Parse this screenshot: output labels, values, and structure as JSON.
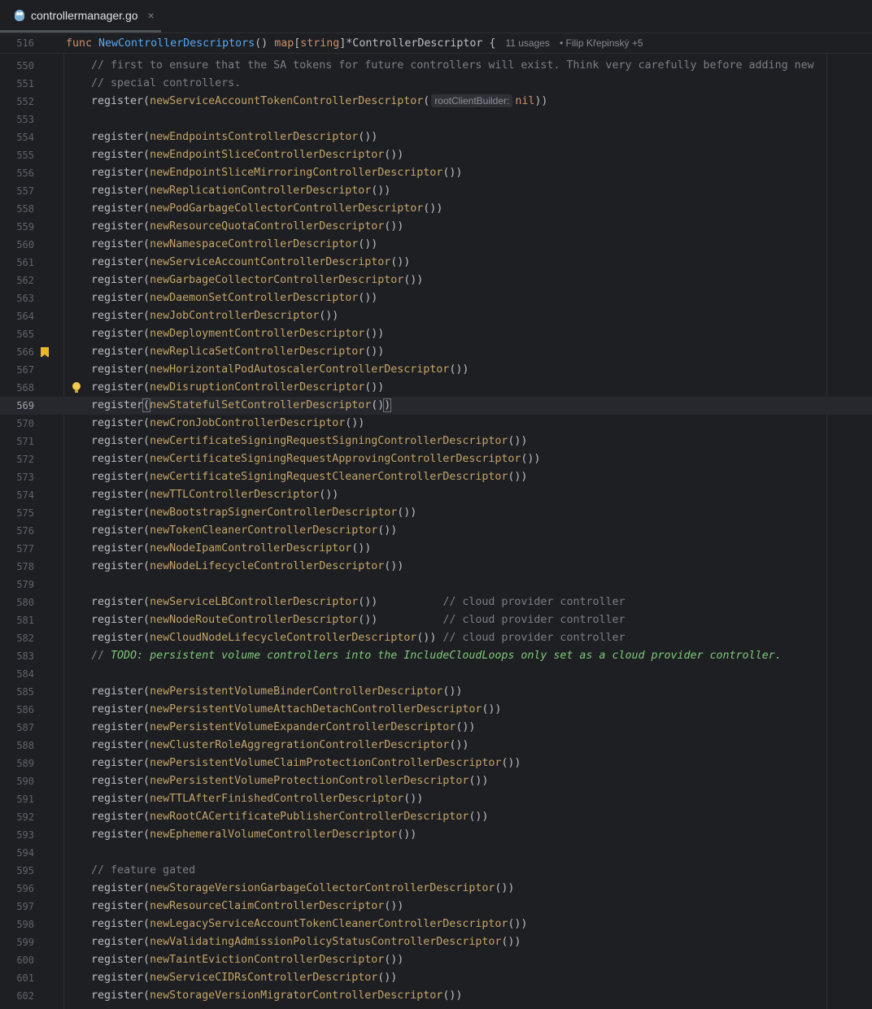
{
  "tab": {
    "file_name": "controllermanager.go",
    "close_glyph": "×",
    "icon": "go-gopher-icon"
  },
  "sticky": {
    "line_number": "516",
    "signature": [
      {
        "t": "func ",
        "c": "kw"
      },
      {
        "t": "NewControllerDescriptors",
        "c": "fn"
      },
      {
        "t": "() ",
        "c": ""
      },
      {
        "t": "map",
        "c": "kw"
      },
      {
        "t": "[",
        "c": ""
      },
      {
        "t": "string",
        "c": "kw"
      },
      {
        "t": "]*ControllerDescriptor {",
        "c": ""
      }
    ],
    "usages": "11 usages",
    "authors": "Filip Křepinský +5"
  },
  "current_line": "569",
  "bookmark_line": "566",
  "bulb_line": "568",
  "lines": [
    {
      "n": "550",
      "kind": "comment",
      "text": "// first to ensure that the SA tokens for future controllers will exist. Think very carefully before adding new"
    },
    {
      "n": "551",
      "kind": "comment",
      "text": "// special controllers."
    },
    {
      "n": "552",
      "kind": "register_hint",
      "call": "newServiceAccountTokenControllerDescriptor",
      "hint": "rootClientBuilder:",
      "arg": "nil"
    },
    {
      "n": "553",
      "kind": "blank"
    },
    {
      "n": "554",
      "kind": "register",
      "call": "newEndpointsControllerDescriptor"
    },
    {
      "n": "555",
      "kind": "register",
      "call": "newEndpointSliceControllerDescriptor"
    },
    {
      "n": "556",
      "kind": "register",
      "call": "newEndpointSliceMirroringControllerDescriptor"
    },
    {
      "n": "557",
      "kind": "register",
      "call": "newReplicationControllerDescriptor"
    },
    {
      "n": "558",
      "kind": "register",
      "call": "newPodGarbageCollectorControllerDescriptor"
    },
    {
      "n": "559",
      "kind": "register",
      "call": "newResourceQuotaControllerDescriptor"
    },
    {
      "n": "560",
      "kind": "register",
      "call": "newNamespaceControllerDescriptor"
    },
    {
      "n": "561",
      "kind": "register",
      "call": "newServiceAccountControllerDescriptor"
    },
    {
      "n": "562",
      "kind": "register",
      "call": "newGarbageCollectorControllerDescriptor"
    },
    {
      "n": "563",
      "kind": "register",
      "call": "newDaemonSetControllerDescriptor"
    },
    {
      "n": "564",
      "kind": "register",
      "call": "newJobControllerDescriptor"
    },
    {
      "n": "565",
      "kind": "register",
      "call": "newDeploymentControllerDescriptor"
    },
    {
      "n": "566",
      "kind": "register",
      "call": "newReplicaSetControllerDescriptor"
    },
    {
      "n": "567",
      "kind": "register",
      "call": "newHorizontalPodAutoscalerControllerDescriptor"
    },
    {
      "n": "568",
      "kind": "register",
      "call": "newDisruptionControllerDescriptor"
    },
    {
      "n": "569",
      "kind": "register",
      "call": "newStatefulSetControllerDescriptor"
    },
    {
      "n": "570",
      "kind": "register",
      "call": "newCronJobControllerDescriptor"
    },
    {
      "n": "571",
      "kind": "register",
      "call": "newCertificateSigningRequestSigningControllerDescriptor"
    },
    {
      "n": "572",
      "kind": "register",
      "call": "newCertificateSigningRequestApprovingControllerDescriptor"
    },
    {
      "n": "573",
      "kind": "register",
      "call": "newCertificateSigningRequestCleanerControllerDescriptor"
    },
    {
      "n": "574",
      "kind": "register",
      "call": "newTTLControllerDescriptor"
    },
    {
      "n": "575",
      "kind": "register",
      "call": "newBootstrapSignerControllerDescriptor"
    },
    {
      "n": "576",
      "kind": "register",
      "call": "newTokenCleanerControllerDescriptor"
    },
    {
      "n": "577",
      "kind": "register",
      "call": "newNodeIpamControllerDescriptor"
    },
    {
      "n": "578",
      "kind": "register",
      "call": "newNodeLifecycleControllerDescriptor"
    },
    {
      "n": "579",
      "kind": "blank"
    },
    {
      "n": "580",
      "kind": "register",
      "call": "newServiceLBControllerDescriptor",
      "trail": "          // cloud provider controller"
    },
    {
      "n": "581",
      "kind": "register",
      "call": "newNodeRouteControllerDescriptor",
      "trail": "          // cloud provider controller"
    },
    {
      "n": "582",
      "kind": "register",
      "call": "newCloudNodeLifecycleControllerDescriptor",
      "trail": " // cloud provider controller"
    },
    {
      "n": "583",
      "kind": "todo",
      "prefix": "// ",
      "text": "TODO: persistent volume controllers into the IncludeCloudLoops only set as a cloud provider controller."
    },
    {
      "n": "584",
      "kind": "blank"
    },
    {
      "n": "585",
      "kind": "register",
      "call": "newPersistentVolumeBinderControllerDescriptor"
    },
    {
      "n": "586",
      "kind": "register",
      "call": "newPersistentVolumeAttachDetachControllerDescriptor"
    },
    {
      "n": "587",
      "kind": "register",
      "call": "newPersistentVolumeExpanderControllerDescriptor"
    },
    {
      "n": "588",
      "kind": "register",
      "call": "newClusterRoleAggregrationControllerDescriptor"
    },
    {
      "n": "589",
      "kind": "register",
      "call": "newPersistentVolumeClaimProtectionControllerDescriptor"
    },
    {
      "n": "590",
      "kind": "register",
      "call": "newPersistentVolumeProtectionControllerDescriptor"
    },
    {
      "n": "591",
      "kind": "register",
      "call": "newTTLAfterFinishedControllerDescriptor"
    },
    {
      "n": "592",
      "kind": "register",
      "call": "newRootCACertificatePublisherControllerDescriptor"
    },
    {
      "n": "593",
      "kind": "register",
      "call": "newEphemeralVolumeControllerDescriptor"
    },
    {
      "n": "594",
      "kind": "blank"
    },
    {
      "n": "595",
      "kind": "comment",
      "text": "// feature gated"
    },
    {
      "n": "596",
      "kind": "register",
      "call": "newStorageVersionGarbageCollectorControllerDescriptor"
    },
    {
      "n": "597",
      "kind": "register",
      "call": "newResourceClaimControllerDescriptor"
    },
    {
      "n": "598",
      "kind": "register",
      "call": "newLegacyServiceAccountTokenCleanerControllerDescriptor"
    },
    {
      "n": "599",
      "kind": "register",
      "call": "newValidatingAdmissionPolicyStatusControllerDescriptor"
    },
    {
      "n": "600",
      "kind": "register",
      "call": "newTaintEvictionControllerDescriptor"
    },
    {
      "n": "601",
      "kind": "register",
      "call": "newServiceCIDRsControllerDescriptor"
    },
    {
      "n": "602",
      "kind": "register",
      "call": "newStorageVersionMigratorControllerDescriptor"
    }
  ],
  "register_word": "register",
  "colors": {
    "background": "#1e1f22",
    "keyword": "#cf8e6d",
    "function": "#56a8f5",
    "call": "#c4a56a",
    "comment": "#7a7e85",
    "todo": "#7ec97a"
  }
}
